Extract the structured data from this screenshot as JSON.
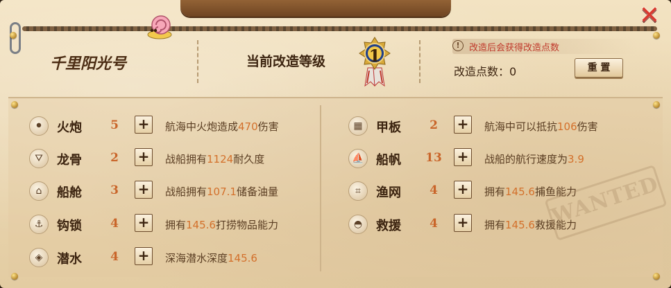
{
  "header": {
    "ship_name": "千里阳光号",
    "level_label": "当前改造等级",
    "level_value": "1",
    "notice_icon": "!",
    "notice_text": "改造后会获得改造点数",
    "points_text": "改造点数：0",
    "reset_label": "重 置",
    "close_glyph": "✕"
  },
  "left_rows": [
    {
      "name": "火炮",
      "level": "5",
      "plus": "+",
      "pre": "航海中火炮造成",
      "val": "470",
      "post": "伤害",
      "icon": "cannon-icon",
      "glyph": "⚫"
    },
    {
      "name": "龙骨",
      "level": "2",
      "plus": "+",
      "pre": "战船拥有",
      "val": "1124",
      "post": "耐久度",
      "icon": "keel-icon",
      "glyph": "⛛"
    },
    {
      "name": "船舱",
      "level": "3",
      "plus": "+",
      "pre": "战船拥有",
      "val": "107.1",
      "post": "储备油量",
      "icon": "cabin-icon",
      "glyph": "⌂"
    },
    {
      "name": "钩锁",
      "level": "4",
      "plus": "+",
      "pre": "拥有",
      "val": "145.6",
      "post": "打捞物品能力",
      "icon": "hook-icon",
      "glyph": "⚓"
    },
    {
      "name": "潜水",
      "level": "4",
      "plus": "+",
      "pre": "深海潜水深度",
      "val": "145.6",
      "post": "",
      "icon": "dive-icon",
      "glyph": "◈"
    }
  ],
  "right_rows": [
    {
      "name": "甲板",
      "level": "2",
      "plus": "+",
      "pre": "航海中可以抵抗",
      "val": "106",
      "post": "伤害",
      "icon": "deck-icon",
      "glyph": "▦"
    },
    {
      "name": "船帆",
      "level": "13",
      "plus": "+",
      "pre": "战船的航行速度为",
      "val": "3.9",
      "post": "",
      "icon": "sail-icon",
      "glyph": "⛵"
    },
    {
      "name": "渔网",
      "level": "4",
      "plus": "+",
      "pre": "拥有",
      "val": "145.6",
      "post": "捕鱼能力",
      "icon": "fishing-net-icon",
      "glyph": "⌗"
    },
    {
      "name": "救援",
      "level": "4",
      "plus": "+",
      "pre": "拥有",
      "val": "145.6",
      "post": "救援能力",
      "icon": "rescue-icon",
      "glyph": "◓"
    }
  ],
  "decor": {
    "stamp_text": "WANTED",
    "value_color": "#d3702b",
    "level_color": "#c9652a",
    "notice_color": "#c0392b",
    "close_color": "#d9392e"
  }
}
